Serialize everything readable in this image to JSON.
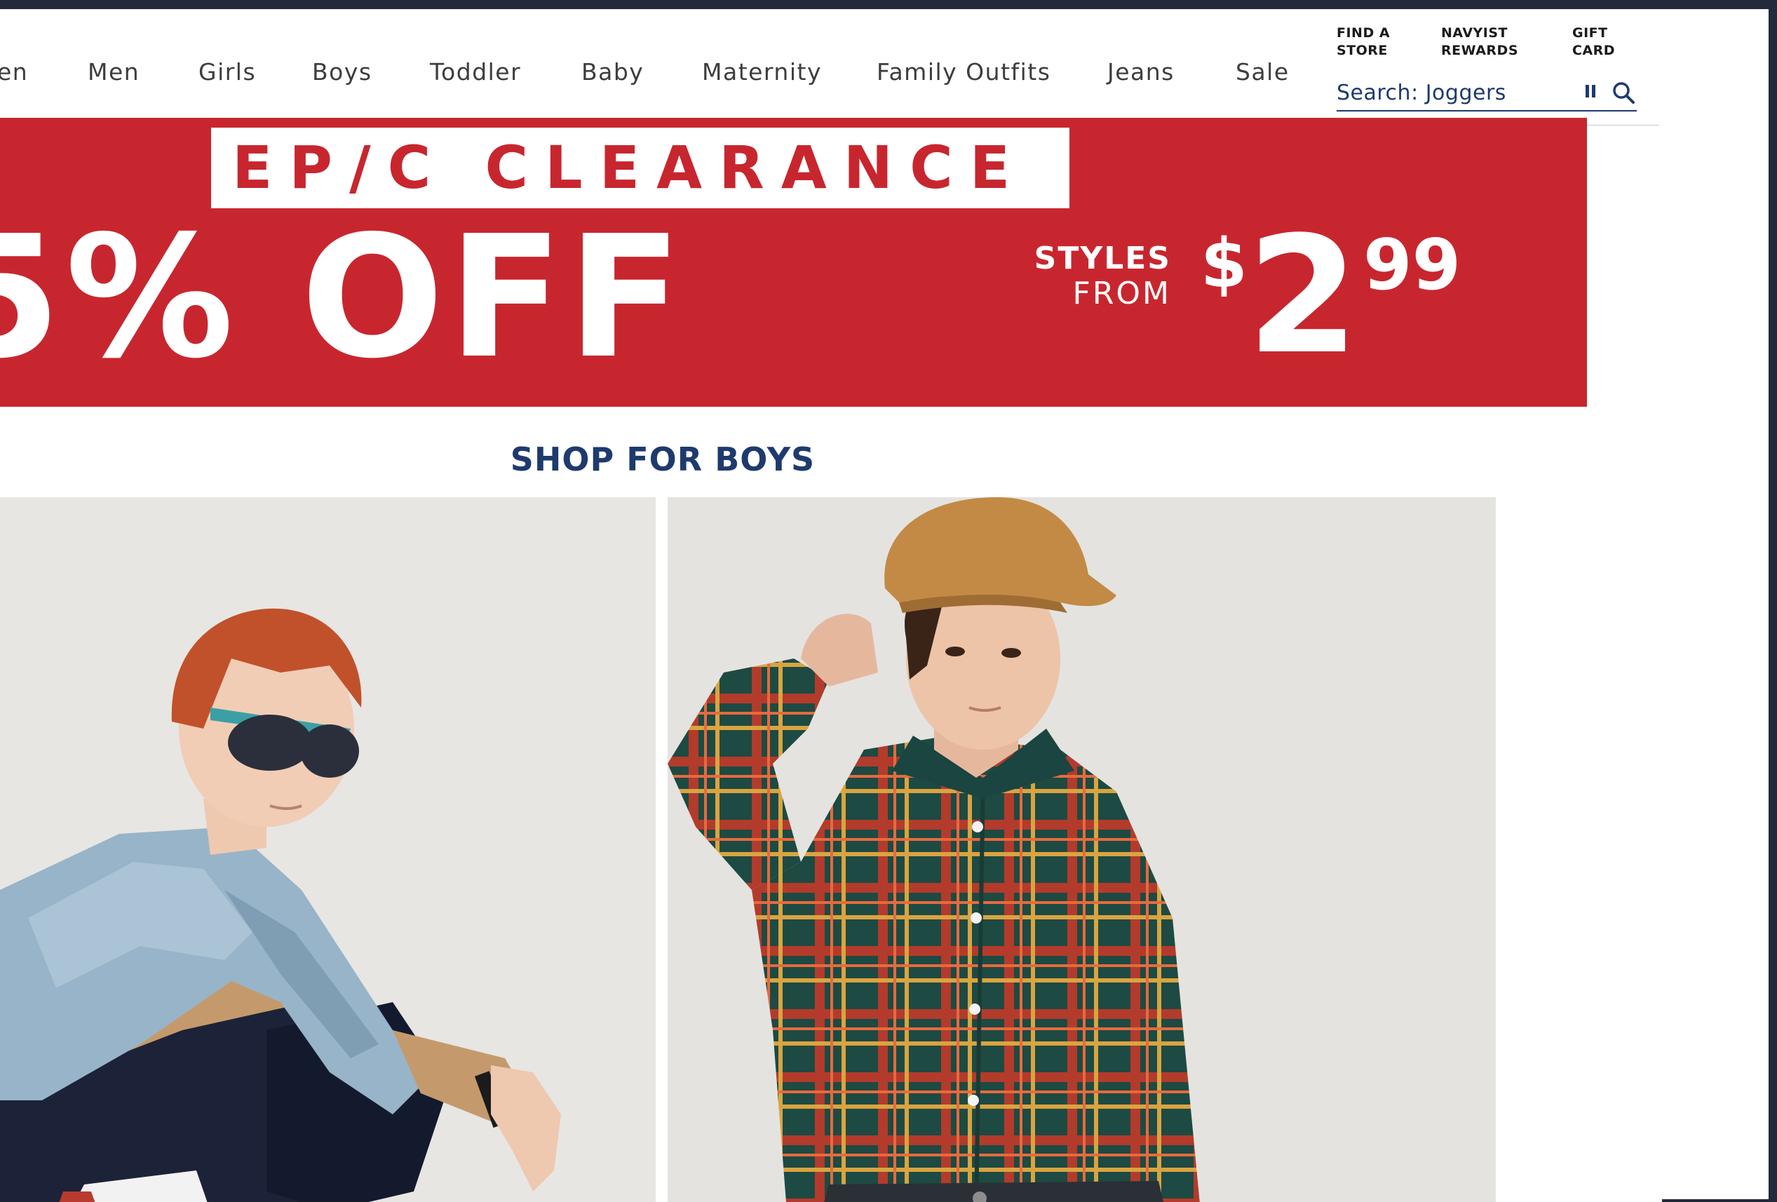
{
  "nav": {
    "items": [
      {
        "label": "en"
      },
      {
        "label": "Men"
      },
      {
        "label": "Girls"
      },
      {
        "label": "Boys"
      },
      {
        "label": "Toddler"
      },
      {
        "label": "Baby"
      },
      {
        "label": "Maternity"
      },
      {
        "label": "Family Outfits"
      },
      {
        "label": "Jeans"
      },
      {
        "label": "Sale"
      }
    ]
  },
  "utility": {
    "find_store": [
      "FIND A",
      "STORE"
    ],
    "rewards": [
      "NAVYIST",
      "REWARDS"
    ],
    "gift_card": [
      "GIFT",
      "CARD"
    ]
  },
  "search": {
    "text": "Search: Joggers"
  },
  "banner": {
    "headline": "EP/C CLEARANCE",
    "discount": "5% OFF",
    "styles_line1": "STYLES",
    "styles_line2": "FROM",
    "price_currency": "$",
    "price_dollars": "2",
    "price_cents": "99"
  },
  "section": {
    "heading": "SHOP FOR BOYS"
  },
  "colors": {
    "brand_red": "#c8262f",
    "navy": "#1e3a6e",
    "frame": "#242a3c"
  },
  "icons": [
    "pause-icon",
    "search-icon"
  ]
}
